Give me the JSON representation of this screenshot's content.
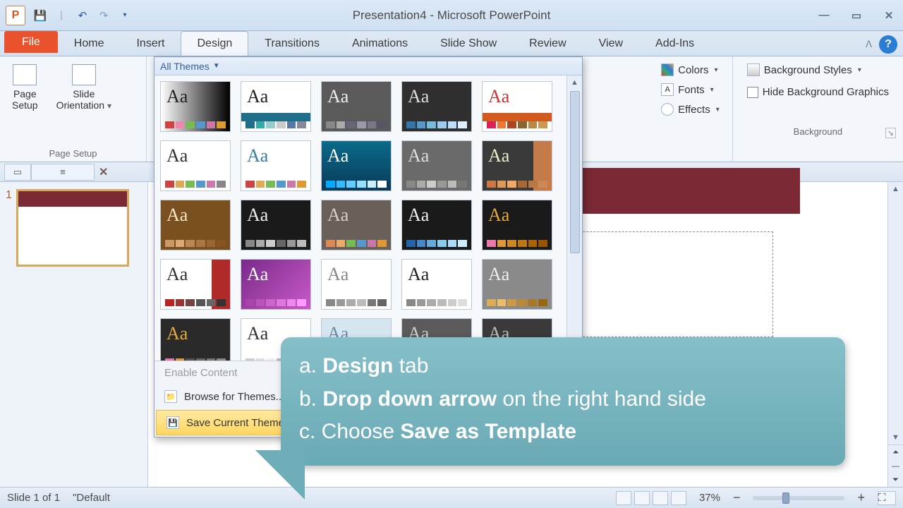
{
  "window": {
    "title": "Presentation4  -  Microsoft PowerPoint",
    "app_letter": "P"
  },
  "qat": {
    "save": "💾",
    "divider": "|",
    "undo": "↶",
    "redo": "↷",
    "more": "▾"
  },
  "win": {
    "min": "—",
    "max": "▭",
    "close": "✕"
  },
  "tabs": {
    "file": "File",
    "home": "Home",
    "insert": "Insert",
    "design": "Design",
    "transitions": "Transitions",
    "animations": "Animations",
    "slideshow": "Slide Show",
    "review": "Review",
    "view": "View",
    "addins": "Add-Ins"
  },
  "ribbon": {
    "page_setup": {
      "page_setup_btn": "Page\nSetup",
      "orientation_btn": "Slide\nOrientation",
      "group": "Page Setup"
    },
    "themes": {
      "header": "All Themes",
      "footer": {
        "enable": "Enable Content",
        "browse": "Browse for Themes...",
        "save": "Save Current Theme..."
      },
      "thumbs": [
        {
          "bg": "#ffffff",
          "aa": "#222",
          "grad": "linear-gradient(90deg,#fff,#000)",
          "sw": [
            "#c44",
            "#e8a",
            "#7b5",
            "#59c",
            "#c7a",
            "#d93"
          ]
        },
        {
          "bg": "#ffffff",
          "aa": "#222",
          "bar": "#1f6f8b",
          "sw": [
            "#1f6f8b",
            "#3aa",
            "#9cc",
            "#ccc",
            "#57a",
            "#889"
          ]
        },
        {
          "bg": "#5a5a5a",
          "aa": "#eee",
          "vign": true,
          "sw": [
            "#888",
            "#aaa",
            "#667",
            "#99a",
            "#778",
            "#556"
          ]
        },
        {
          "bg": "#2f2f2f",
          "aa": "#ddd",
          "sw": [
            "#37a",
            "#59c",
            "#7bd",
            "#9ce",
            "#bdf",
            "#def"
          ]
        },
        {
          "bg": "#ffffff",
          "aa": "#c33",
          "bar": "#d25a1e",
          "sw": [
            "#d25",
            "#e73",
            "#a42",
            "#863",
            "#b84",
            "#c95"
          ]
        },
        {
          "bg": "#ffffff",
          "aa": "#333",
          "sw": [
            "#c44",
            "#da5",
            "#7b5",
            "#59c",
            "#c7a",
            "#888"
          ]
        },
        {
          "bg": "#ffffff",
          "aa": "#3a7ba6",
          "sw": [
            "#c44",
            "#da5",
            "#7b5",
            "#59c",
            "#c7a",
            "#d93"
          ]
        },
        {
          "bg": "linear-gradient(#0a6a8a,#0a3a5a)",
          "aa": "#fff",
          "sw": [
            "#0af",
            "#3bf",
            "#6cf",
            "#9df",
            "#cef",
            "#fff"
          ]
        },
        {
          "bg": "#6a6a6a",
          "aa": "#ddd",
          "sw": [
            "#888",
            "#aaa",
            "#ccc",
            "#999",
            "#bbb",
            "#777"
          ]
        },
        {
          "bg": "#3a3a3a",
          "aa": "#eec",
          "side": "#c57a4a",
          "sw": [
            "#c74",
            "#d95",
            "#ea6",
            "#a63",
            "#b74",
            "#c85"
          ]
        },
        {
          "bg": "#7a5020",
          "aa": "#f5e6c8",
          "sw": [
            "#c96",
            "#da7",
            "#b85",
            "#a74",
            "#963",
            "#852"
          ]
        },
        {
          "bg": "#1a1a1a",
          "aa": "#eee",
          "sw": [
            "#888",
            "#aaa",
            "#ccc",
            "#666",
            "#999",
            "#bbb"
          ]
        },
        {
          "bg": "#6a605a",
          "aa": "#d8cfc8",
          "sw": [
            "#d85",
            "#ea6",
            "#7b5",
            "#59c",
            "#c7a",
            "#d93"
          ]
        },
        {
          "bg": "#1a1a1a",
          "aa": "#eee",
          "sw": [
            "#26a",
            "#48c",
            "#6ad",
            "#8ce",
            "#adf",
            "#cef"
          ]
        },
        {
          "bg": "#1a1a1a",
          "aa": "#e7a83a",
          "sw": [
            "#e7a",
            "#d93",
            "#c82",
            "#b71",
            "#a60",
            "#950"
          ]
        },
        {
          "bg": "#ffffff",
          "aa": "#333",
          "side": "#b02a2a",
          "sw": [
            "#b22",
            "#933",
            "#744",
            "#555",
            "#666",
            "#333"
          ]
        },
        {
          "bg": "linear-gradient(135deg,#7a2a8a,#c85ac8)",
          "aa": "#fff",
          "sw": [
            "#a4a",
            "#b5b",
            "#c6c",
            "#d7d",
            "#e8e",
            "#f9f"
          ]
        },
        {
          "bg": "#ffffff",
          "aa": "#888",
          "accent": "#e7a23a",
          "sw": [
            "#888",
            "#999",
            "#aaa",
            "#bbb",
            "#777",
            "#666"
          ]
        },
        {
          "bg": "#ffffff",
          "aa": "#222",
          "frame": true,
          "sw": [
            "#888",
            "#999",
            "#aaa",
            "#bbb",
            "#ccc",
            "#ddd"
          ]
        },
        {
          "bg": "#8a8a8a",
          "aa": "#eee",
          "sw": [
            "#da5",
            "#eb6",
            "#c94",
            "#b83",
            "#a72",
            "#961"
          ]
        },
        {
          "bg": "#2a2a2a",
          "aa": "#e7a83a",
          "sw": [
            "#e7a",
            "#d93",
            "#555",
            "#666",
            "#777",
            "#888"
          ]
        },
        {
          "bg": "#ffffff",
          "aa": "#333",
          "sw": [
            "#ccc",
            "#ddd",
            "#eee",
            "#bbb",
            "#aaa",
            "#999"
          ]
        },
        {
          "bg": "#d6e6f0",
          "aa": "#6a8aa6",
          "sw": [
            "#8ac",
            "#9bd",
            "#ace",
            "#bdf",
            "#cef",
            "#def"
          ]
        },
        {
          "bg": "#5a5a5a",
          "aa": "#ccc",
          "sw": [
            "#888",
            "#999",
            "#aaa",
            "#777",
            "#666",
            "#555"
          ]
        },
        {
          "bg": "#3a3a3a",
          "aa": "#bbb",
          "sw": [
            "#666",
            "#777",
            "#888",
            "#999",
            "#aaa",
            "#bbb"
          ]
        },
        {
          "bg": "linear-gradient(#5a7a6a,#3a5a4a)",
          "aa": "#cde",
          "frame2": true,
          "sw": [
            "#6a8",
            "#7b9",
            "#8ca",
            "#9db",
            "#aec",
            "#bfd"
          ]
        },
        {
          "bg": "#f5eec8",
          "aa": "#8a7a3a",
          "sw": [
            "#c94",
            "#da5",
            "#a83",
            "#b94",
            "#ca5",
            "#db6"
          ]
        }
      ]
    },
    "variants": {
      "colors": "Colors",
      "fonts": "Fonts",
      "effects": "Effects"
    },
    "background": {
      "styles": "Background Styles",
      "hide": "Hide Background Graphics",
      "group": "Background"
    }
  },
  "thumbnails": {
    "slide1_num": "1"
  },
  "callout": {
    "a_pre": "a. ",
    "a_b": "Design",
    "a_post": " tab",
    "b_pre": "b. ",
    "b_b": "Drop down arrow",
    "b_post": " on the right hand side",
    "c_pre": "c. Choose ",
    "c_b": "Save as Template"
  },
  "status": {
    "slide": "Slide 1 of 1",
    "theme": "\"Default",
    "zoom": "37%"
  }
}
